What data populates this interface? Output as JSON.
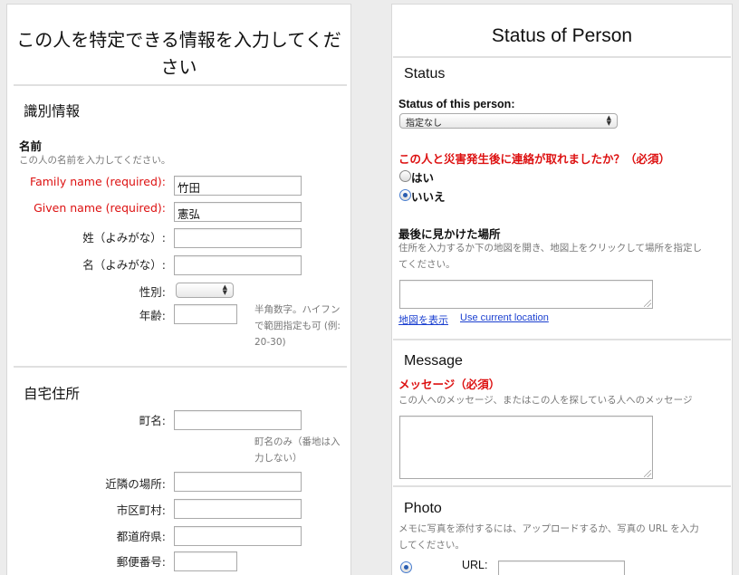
{
  "left": {
    "title": "この人を特定できる情報を入力してください",
    "identification": {
      "heading": "識別情報",
      "name_label": "名前",
      "name_help": "この人の名前を入力してください。",
      "family_name_label": "Family name (required):",
      "family_name_value": "竹田",
      "given_name_label": "Given name (required):",
      "given_name_value": "憲弘",
      "family_kana_label": "姓（よみがな）:",
      "given_kana_label": "名（よみがな）:",
      "sex_label": "性別:",
      "age_label": "年齢:",
      "age_help": "半角数字。ハイフンで範囲指定も可 (例: 20-30)"
    },
    "address": {
      "heading": "自宅住所",
      "street_label": "町名:",
      "street_help": "町名のみ（番地は入力しない）",
      "neighborhood_label": "近隣の場所:",
      "city_label": "市区町村:",
      "prefecture_label": "都道府県:",
      "postal_label": "郵便番号:"
    }
  },
  "right": {
    "title": "Status of Person",
    "status": {
      "heading": "Status",
      "status_label": "Status of this person:",
      "status_selected": "指定なし",
      "contact_question": "この人と災害発生後に連絡が取れましたか？（必須）",
      "option_yes": "はい",
      "option_no": "いいえ",
      "selected_option": "no"
    },
    "last_seen": {
      "label": "最後に見かけた場所",
      "help": "住所を入力するか下の地図を開き、地図上をクリックして場所を指定してください。",
      "show_map_link": "地図を表示",
      "current_location_link": "Use current location"
    },
    "message": {
      "heading": "Message",
      "label": "メッセージ（必須）",
      "help": "この人へのメッセージ、またはこの人を探している人へのメッセージ"
    },
    "photo": {
      "heading": "Photo",
      "help": "メモに写真を添付するには、アップロードするか、写真の URL を入力してください。",
      "url_label": "URL:"
    }
  },
  "colors": {
    "required": "#dd1111",
    "link": "#1a3fd0",
    "radio_selected": "#2a5db0"
  }
}
